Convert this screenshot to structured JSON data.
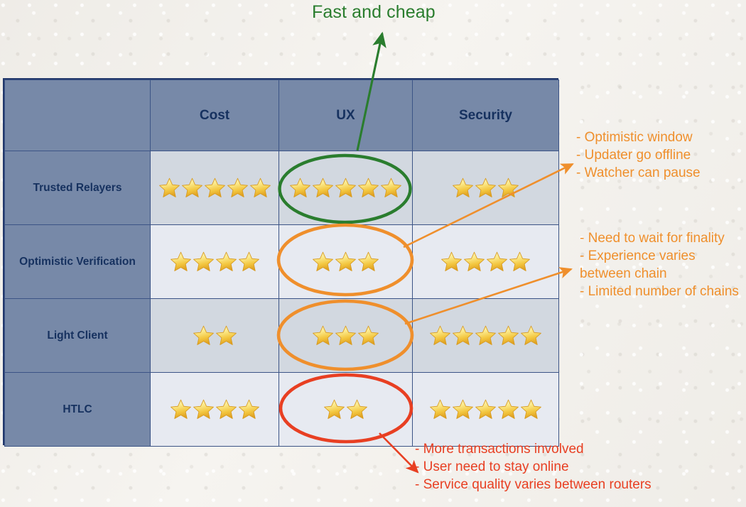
{
  "slide": {
    "title_callout": "Fast and cheap",
    "title_color": "#2a7d2e"
  },
  "colors": {
    "header_bg": "#7789a8",
    "grid_line": "#3c5486",
    "table_border": "#22386b",
    "row_shade_dark": "#d2d8e0",
    "row_shade_light": "#e7eaf1",
    "label_text": "#16315f",
    "green": "#2a7d2e",
    "orange": "#ef8f2c",
    "red": "#e83f22",
    "star_gold": "#f0c03c",
    "background": "#f3f1ed"
  },
  "table": {
    "columns": [
      "",
      "Cost",
      "UX",
      "Security"
    ],
    "rows": [
      {
        "label": "Trusted Relayers",
        "shade": "dark",
        "cost_stars": 5,
        "ux_stars": 5,
        "security_stars": 3
      },
      {
        "label": "Optimistic Verification",
        "shade": "light",
        "cost_stars": 4,
        "ux_stars": 3,
        "security_stars": 4
      },
      {
        "label": "Light Client",
        "shade": "dark",
        "cost_stars": 2,
        "ux_stars": 3,
        "security_stars": 5
      },
      {
        "label": "HTLC",
        "shade": "light",
        "cost_stars": 4,
        "ux_stars": 2,
        "security_stars": 5
      }
    ]
  },
  "highlights": [
    {
      "name": "trusted-relayers-ux",
      "color": "#2a7d2e"
    },
    {
      "name": "optimistic-verification-ux",
      "color": "#ef8f2c"
    },
    {
      "name": "light-client-ux",
      "color": "#ef8f2c"
    },
    {
      "name": "htlc-ux",
      "color": "#e83f22"
    }
  ],
  "annotations": {
    "optimistic": "- Optimistic window\n-  Updater go offline\n-  Watcher can pause",
    "light_client": "- Need to wait for finality\n- Experience varies between chain\n- Limited number of chains",
    "htlc": "- More transactions involved\n- User need to stay online\n- Service quality varies between routers"
  },
  "icons": {
    "star": "star-icon",
    "arrow": "arrow-icon",
    "ellipse": "ellipse-highlight-icon"
  }
}
